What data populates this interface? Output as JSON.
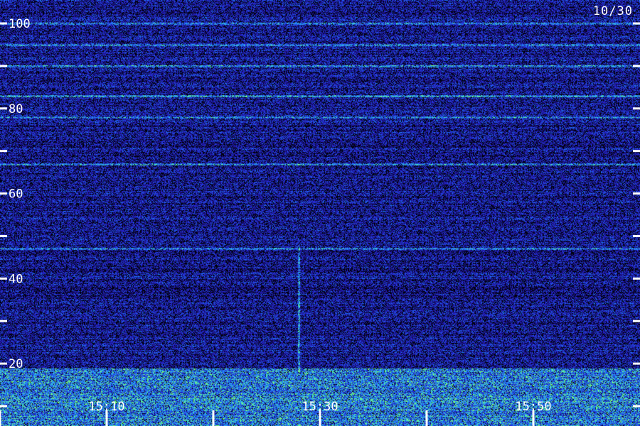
{
  "chart_data": {
    "type": "heatmap",
    "title": "",
    "xlabel": "",
    "ylabel": "",
    "date_label": "10/30",
    "x_tick_labels": [
      "15:10",
      "15:30",
      "15:50"
    ],
    "x_minor_ticks": [
      "15:00",
      "15:10",
      "15:20",
      "15:30",
      "15:40",
      "15:50"
    ],
    "x_range": [
      "14:57",
      "15:57"
    ],
    "y_tick_labels": [
      "20",
      "40",
      "60",
      "80",
      "100"
    ],
    "y_minor_ticks": [
      10,
      20,
      30,
      40,
      50,
      60,
      70,
      80,
      90,
      100
    ],
    "ylim": [
      10,
      105
    ],
    "colormap": {
      "background": "#000000",
      "low": "#1a0a80",
      "mid": "#3a2ee0",
      "high": "#2fb0ff",
      "peak": "#7dff7a"
    },
    "features": {
      "horizontal_lines_y": [
        100,
        95,
        90,
        83,
        78,
        67,
        47
      ],
      "vertical_burst_time": "15:28",
      "vertical_burst_y_range": [
        18,
        48
      ],
      "low_band_y_range": [
        10,
        19
      ]
    }
  }
}
